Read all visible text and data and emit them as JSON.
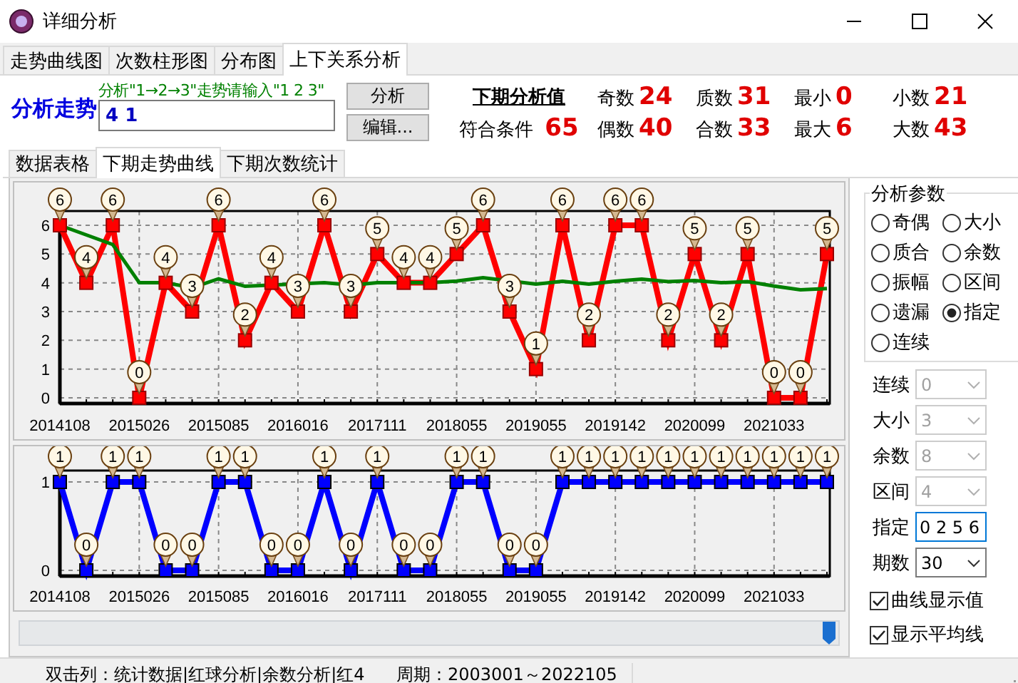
{
  "window": {
    "title": "详细分析"
  },
  "main_tabs": [
    {
      "label": "走势曲线图",
      "selected": false
    },
    {
      "label": "次数柱形图",
      "selected": false
    },
    {
      "label": "分布图",
      "selected": false
    },
    {
      "label": "上下关系分析",
      "selected": true
    }
  ],
  "analysis": {
    "title": "分析走势",
    "hint": "分析\"1→2→3\"走势请输入\"1 2 3\"",
    "value": "4 1",
    "buttons": [
      "分析",
      "编辑..."
    ]
  },
  "next_value": {
    "title": "下期分析值",
    "match_label": "符合条件",
    "match_value": "65"
  },
  "stats": [
    {
      "label": "奇数",
      "value": "24"
    },
    {
      "label": "偶数",
      "value": "40"
    },
    {
      "label": "质数",
      "value": "31"
    },
    {
      "label": "合数",
      "value": "33"
    },
    {
      "label": "最小",
      "value": "0"
    },
    {
      "label": "最大",
      "value": "6"
    },
    {
      "label": "小数",
      "value": "21"
    },
    {
      "label": "大数",
      "value": "43"
    }
  ],
  "sub_tabs": [
    {
      "label": "数据表格",
      "selected": false
    },
    {
      "label": "下期走势曲线",
      "selected": true
    },
    {
      "label": "下期次数统计",
      "selected": false
    }
  ],
  "charts": [
    {
      "chart_data": {
        "type": "line",
        "ylim": [
          0,
          6
        ],
        "yticks": [
          0,
          1,
          2,
          3,
          4,
          5,
          6
        ],
        "grid": true,
        "categories": [
          "2014108",
          null,
          null,
          "2015026",
          null,
          null,
          "2015085",
          null,
          null,
          "2016016",
          null,
          null,
          "2017111",
          null,
          null,
          "2018055",
          null,
          null,
          "2019055",
          null,
          null,
          "2019142",
          null,
          null,
          "2020099",
          null,
          null,
          "2021033",
          null,
          null
        ],
        "series": [
          {
            "color": "#ff0000",
            "marker": "square",
            "values": [
              6,
              4,
              6,
              0,
              4,
              3,
              6,
              2,
              4,
              3,
              6,
              3,
              5,
              4,
              4,
              5,
              6,
              3,
              1,
              6,
              2,
              6,
              6,
              2,
              5,
              2,
              5,
              0,
              0,
              5
            ],
            "value_labels": [
              "6",
              "4",
              "6",
              "0",
              "4",
              "3",
              "6",
              "2",
              "4",
              "3",
              "6",
              "3",
              "5",
              "4",
              "4",
              "5",
              "6",
              "3",
              "1",
              "6",
              "2",
              "6",
              "6",
              "2",
              "5",
              "2",
              "5",
              "0",
              "0",
              "5"
            ]
          },
          {
            "color": "#008000",
            "values": [
              6,
              null,
              5.33,
              4,
              4,
              3.83,
              4.14,
              3.88,
              null,
              null,
              4,
              3.92,
              4,
              4,
              4,
              4.06,
              4.18,
              null,
              3.95,
              4.05,
              3.95,
              4.05,
              4.13,
              4.04,
              4.08,
              4,
              4.04,
              3.89,
              3.76,
              3.8
            ]
          }
        ]
      }
    },
    {
      "chart_data": {
        "type": "line",
        "ylim": [
          0,
          1
        ],
        "yticks": [
          0,
          1
        ],
        "grid": true,
        "categories": [
          "2014108",
          null,
          null,
          "2015026",
          null,
          null,
          "2015085",
          null,
          null,
          "2016016",
          null,
          null,
          "2017111",
          null,
          null,
          "2018055",
          null,
          null,
          "2019055",
          null,
          null,
          "2019142",
          null,
          null,
          "2020099",
          null,
          null,
          "2021033",
          null,
          null
        ],
        "series": [
          {
            "color": "#0000ff",
            "marker": "square",
            "values": [
              1,
              0,
              1,
              1,
              0,
              0,
              1,
              1,
              0,
              0,
              1,
              0,
              1,
              0,
              0,
              1,
              1,
              0,
              0,
              1,
              1,
              1,
              1,
              1,
              1,
              1,
              1,
              1,
              1,
              1
            ],
            "value_labels": [
              "1",
              "0",
              "1",
              "1",
              "0",
              "0",
              "1",
              "1",
              "0",
              "0",
              "1",
              "0",
              "1",
              "0",
              "0",
              "1",
              "1",
              "0",
              "0",
              "1",
              "1",
              "1",
              "1",
              "1",
              "1",
              "1",
              "1",
              "1",
              "1",
              "1"
            ]
          }
        ]
      }
    }
  ],
  "params": {
    "title": "分析参数",
    "options": [
      {
        "label": "奇偶",
        "selected": false
      },
      {
        "label": "大小",
        "selected": false
      },
      {
        "label": "质合",
        "selected": false
      },
      {
        "label": "余数",
        "selected": false
      },
      {
        "label": "振幅",
        "selected": false
      },
      {
        "label": "区间",
        "selected": false
      },
      {
        "label": "遗漏",
        "selected": false
      },
      {
        "label": "指定",
        "selected": true
      },
      {
        "label": "连续",
        "selected": false
      }
    ]
  },
  "settings": [
    {
      "label": "连续",
      "kind": "select",
      "value": "0",
      "disabled": true
    },
    {
      "label": "大小",
      "kind": "select",
      "value": "3",
      "disabled": true
    },
    {
      "label": "余数",
      "kind": "select",
      "value": "8",
      "disabled": true
    },
    {
      "label": "区间",
      "kind": "select",
      "value": "4",
      "disabled": true
    },
    {
      "label": "指定",
      "kind": "text",
      "value": "0 2 5 6",
      "disabled": false
    },
    {
      "label": "期数",
      "kind": "select",
      "value": "30",
      "disabled": false
    }
  ],
  "checks": [
    {
      "label": "曲线显示值",
      "checked": true
    },
    {
      "label": "显示平均线",
      "checked": true
    }
  ],
  "status_bar": {
    "double_click": "双击列：统计数据|红球分析|余数分析|红4",
    "period": "周期：2003001～2022105"
  }
}
